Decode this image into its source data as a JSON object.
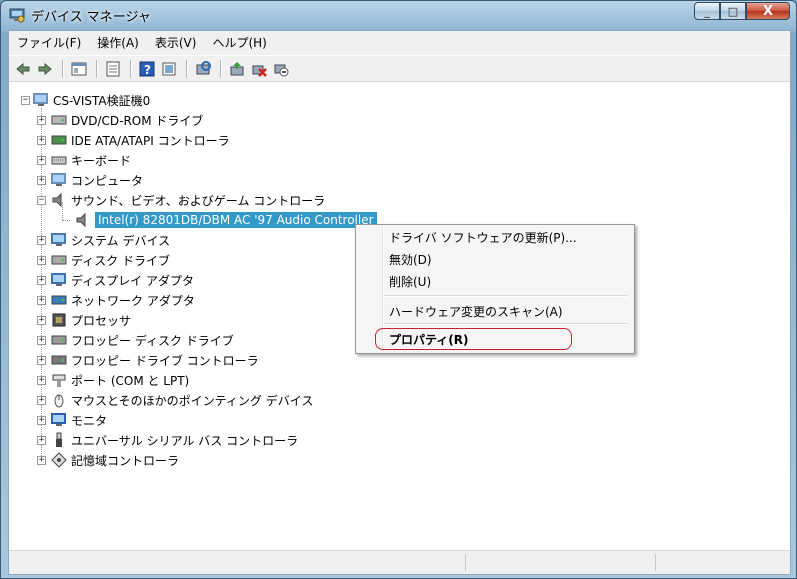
{
  "window": {
    "title": "デバイス マネージャ",
    "controls": {
      "minimize": "_",
      "maximize": "□",
      "close": "X"
    }
  },
  "menubar": {
    "items": [
      "ファイル(F)",
      "操作(A)",
      "表示(V)",
      "ヘルプ(H)"
    ]
  },
  "toolbar": {
    "buttons": [
      "back-icon",
      "forward-icon",
      "show-hide-tree-icon",
      "properties-icon",
      "help-icon",
      "scan-hardware-icon",
      "update-driver-icon",
      "uninstall-icon",
      "disable-icon"
    ]
  },
  "tree": {
    "root": "CS-VISTA検証機0",
    "categories": [
      {
        "label": "DVD/CD-ROM ドライブ",
        "icon": "dvd-drive-icon"
      },
      {
        "label": "IDE ATA/ATAPI コントローラ",
        "icon": "ide-controller-icon"
      },
      {
        "label": "キーボード",
        "icon": "keyboard-icon"
      },
      {
        "label": "コンピュータ",
        "icon": "computer-icon"
      },
      {
        "label": "サウンド、ビデオ、およびゲーム コントローラ",
        "icon": "sound-icon",
        "expanded": true,
        "children": [
          {
            "label": "Intel(r) 82801DB/DBM AC '97 Audio Controller",
            "icon": "speaker-icon",
            "selected": true
          }
        ]
      },
      {
        "label": "システム デバイス",
        "icon": "system-device-icon"
      },
      {
        "label": "ディスク ドライブ",
        "icon": "disk-drive-icon"
      },
      {
        "label": "ディスプレイ アダプタ",
        "icon": "display-adapter-icon"
      },
      {
        "label": "ネットワーク アダプタ",
        "icon": "network-adapter-icon"
      },
      {
        "label": "プロセッサ",
        "icon": "processor-icon"
      },
      {
        "label": "フロッピー ディスク ドライブ",
        "icon": "floppy-drive-icon"
      },
      {
        "label": "フロッピー ドライブ コントローラ",
        "icon": "floppy-controller-icon"
      },
      {
        "label": "ポート (COM と LPT)",
        "icon": "port-icon"
      },
      {
        "label": "マウスとそのほかのポインティング デバイス",
        "icon": "mouse-icon"
      },
      {
        "label": "モニタ",
        "icon": "monitor-icon"
      },
      {
        "label": "ユニバーサル シリアル バス コントローラ",
        "icon": "usb-icon"
      },
      {
        "label": "記憶域コントローラ",
        "icon": "storage-controller-icon"
      }
    ]
  },
  "context_menu": {
    "update_driver": "ドライバ ソフトウェアの更新(P)...",
    "disable": "無効(D)",
    "uninstall": "削除(U)",
    "scan_hardware": "ハードウェア変更のスキャン(A)",
    "properties": "プロパティ(R)"
  },
  "colors": {
    "selection": "#3399c9",
    "highlight_ring": "#c8202c"
  }
}
